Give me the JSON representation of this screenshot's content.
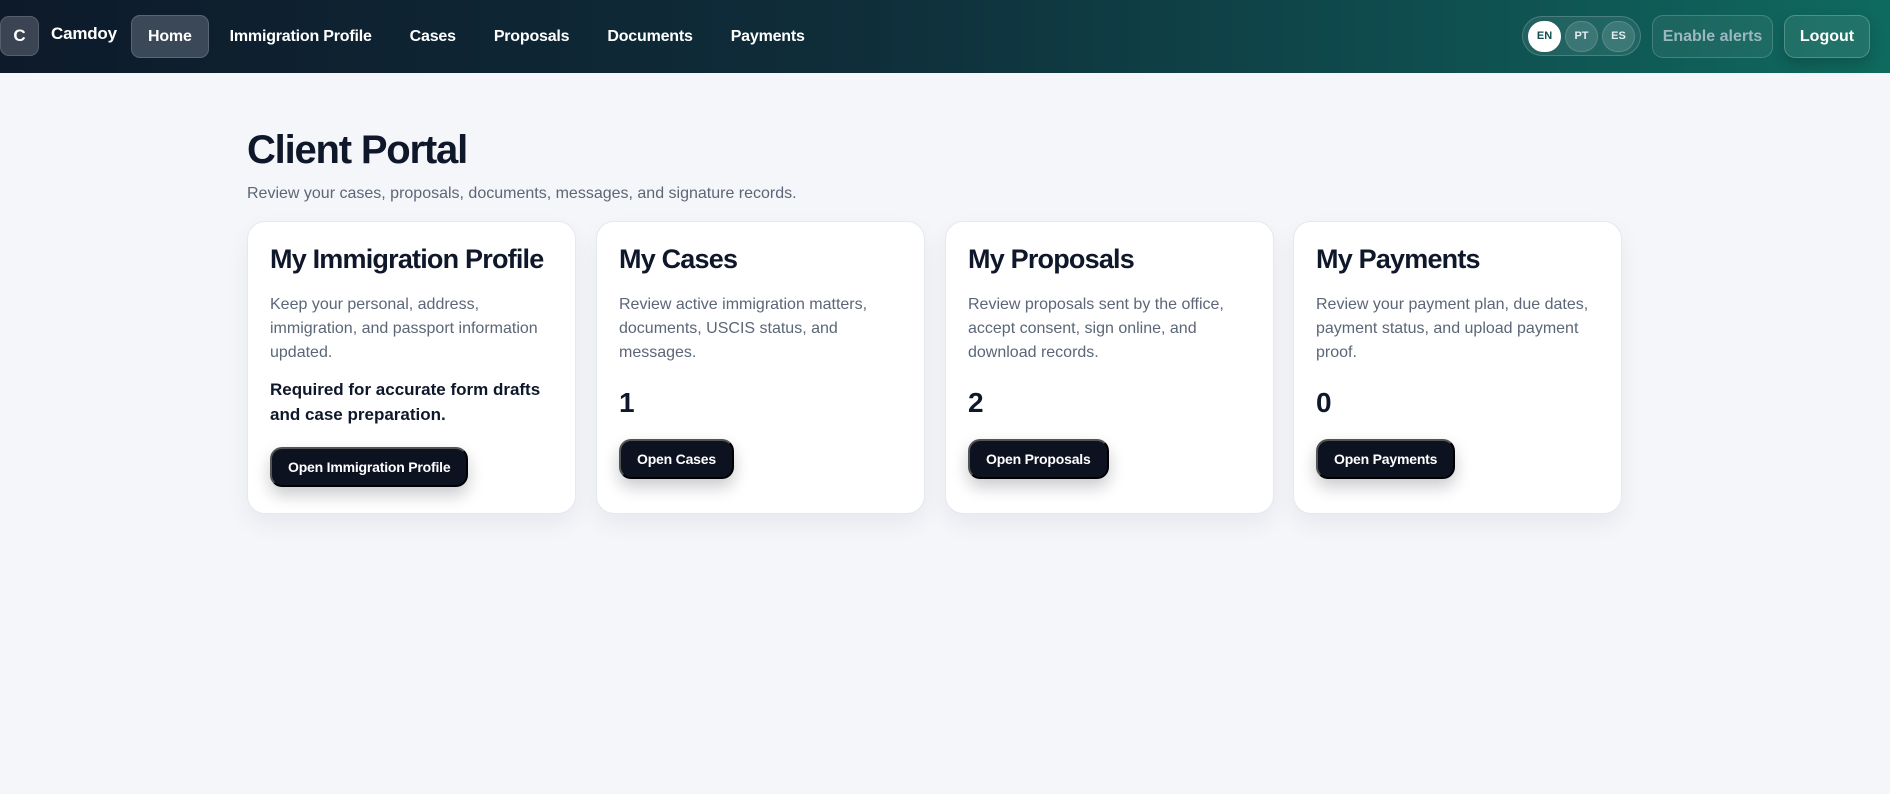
{
  "brand": {
    "initial": "C",
    "name": "Camdoy"
  },
  "nav": {
    "items": [
      {
        "label": "Home",
        "active": true
      },
      {
        "label": "Immigration Profile",
        "active": false
      },
      {
        "label": "Cases",
        "active": false
      },
      {
        "label": "Proposals",
        "active": false
      },
      {
        "label": "Documents",
        "active": false
      },
      {
        "label": "Payments",
        "active": false
      }
    ]
  },
  "languages": {
    "options": [
      "EN",
      "PT",
      "ES"
    ],
    "selected": "EN"
  },
  "actions": {
    "alerts_label": "Enable alerts",
    "logout_label": "Logout"
  },
  "page": {
    "title": "Client Portal",
    "subtitle": "Review your cases, proposals, documents, messages, and signature records."
  },
  "cards": [
    {
      "title": "My Immigration Profile",
      "description": "Keep your personal, address, immigration, and passport information updated.",
      "note": "Required for accurate form drafts and case preparation.",
      "button": "Open Immigration Profile"
    },
    {
      "title": "My Cases",
      "description": "Review active immigration matters, documents, USCIS status, and messages.",
      "count": "1",
      "button": "Open Cases"
    },
    {
      "title": "My Proposals",
      "description": "Review proposals sent by the office, accept consent, sign online, and download records.",
      "count": "2",
      "button": "Open Proposals"
    },
    {
      "title": "My Payments",
      "description": "Review your payment plan, due dates, payment status, and upload payment proof.",
      "count": "0",
      "button": "Open Payments"
    }
  ],
  "colors": {
    "header_start": "#0d1a2a",
    "header_end": "#0f6a5e",
    "page_bg": "#f5f6fa",
    "button_dark": "#0c1220",
    "text_primary": "#0f172a",
    "text_muted": "#5b6677"
  }
}
